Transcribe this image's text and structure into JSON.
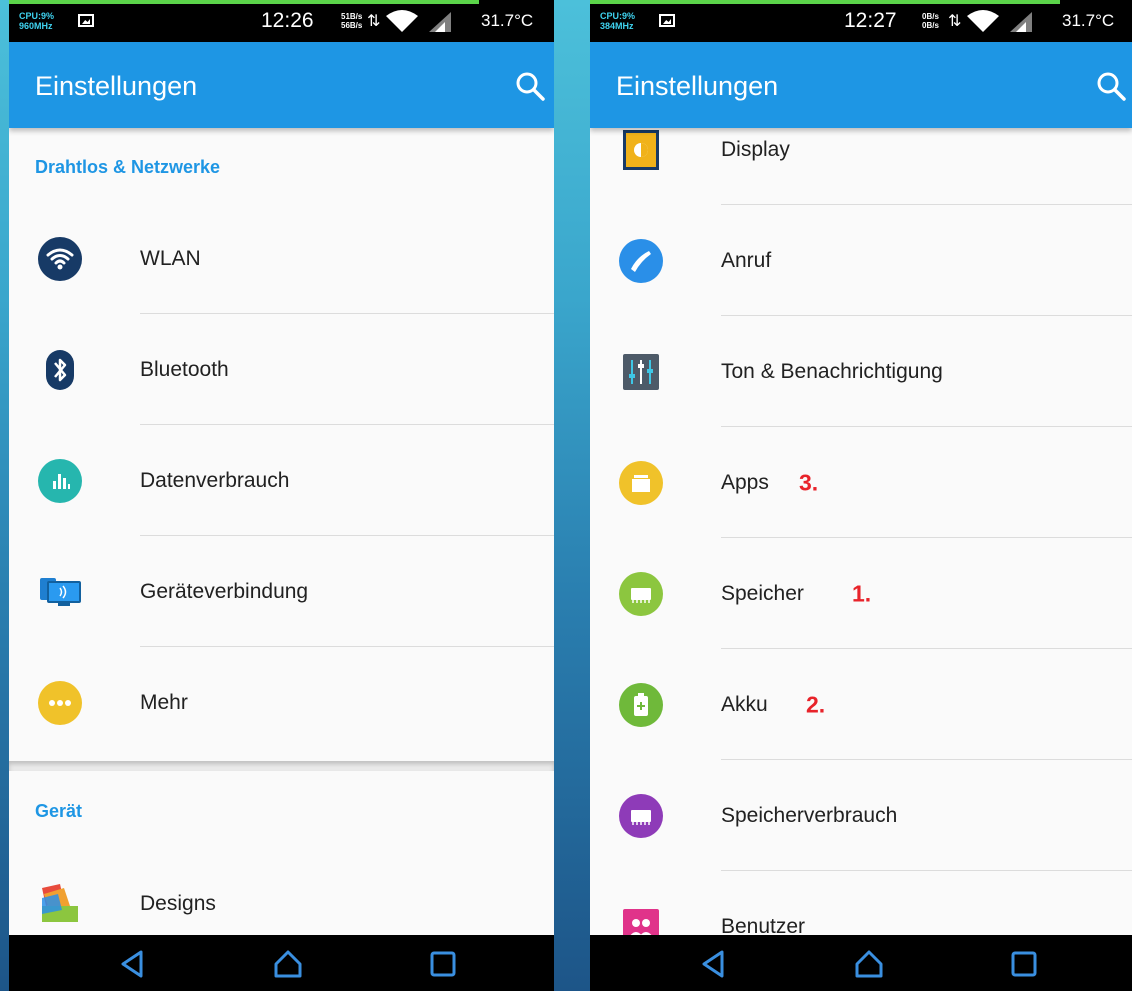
{
  "left_screen": {
    "status_bar": {
      "cpu_line1": "CPU:9%",
      "cpu_line2": "960MHz",
      "time": "12:26",
      "net_up": "51B/s",
      "net_down": "56B/s",
      "temperature": "31.7°C"
    },
    "app_bar": {
      "title": "Einstellungen",
      "search_icon": "search-icon"
    },
    "sections": [
      {
        "header": "Drahtlos & Netzwerke",
        "items": [
          {
            "label": "WLAN",
            "icon": "wifi-icon",
            "color": "#173a66"
          },
          {
            "label": "Bluetooth",
            "icon": "bluetooth-icon",
            "color": "#173a66"
          },
          {
            "label": "Datenverbrauch",
            "icon": "data-usage-icon",
            "color": "#26b6ae"
          },
          {
            "label": "Geräteverbindung",
            "icon": "device-connection-icon",
            "color": "#1f7fd0"
          },
          {
            "label": "Mehr",
            "icon": "more-icon",
            "color": "#f0c22a"
          }
        ]
      },
      {
        "header": "Gerät",
        "items": [
          {
            "label": "Designs",
            "icon": "designs-icon",
            "color": "#e84b3c"
          }
        ]
      }
    ],
    "nav_bar": {
      "back": "back-icon",
      "home": "home-icon",
      "recents": "recents-icon"
    }
  },
  "right_screen": {
    "status_bar": {
      "cpu_line1": "CPU:9%",
      "cpu_line2": "384MHz",
      "time": "12:27",
      "net_up": "0B/s",
      "net_down": "0B/s",
      "temperature": "31.7°C"
    },
    "app_bar": {
      "title": "Einstellungen",
      "search_icon": "search-icon"
    },
    "items": [
      {
        "label": "Display",
        "icon": "display-icon",
        "color": "#f0b21a",
        "annotation": ""
      },
      {
        "label": "Anruf",
        "icon": "call-icon",
        "color": "#2a8fe8",
        "annotation": ""
      },
      {
        "label": "Ton & Benachrichtigung",
        "icon": "sound-icon",
        "color": "#4d5a68",
        "annotation": ""
      },
      {
        "label": "Apps",
        "icon": "apps-icon",
        "color": "#f0c22a",
        "annotation": "3."
      },
      {
        "label": "Speicher",
        "icon": "storage-icon",
        "color": "#8cc63f",
        "annotation": "1."
      },
      {
        "label": "Akku",
        "icon": "battery-icon",
        "color": "#6fb93a",
        "annotation": "2."
      },
      {
        "label": "Speicherverbrauch",
        "icon": "memory-icon",
        "color": "#8e3bb8",
        "annotation": ""
      },
      {
        "label": "Benutzer",
        "icon": "user-icon",
        "color": "#e0338a",
        "annotation": ""
      }
    ],
    "nav_bar": {
      "back": "back-icon",
      "home": "home-icon",
      "recents": "recents-icon"
    }
  }
}
